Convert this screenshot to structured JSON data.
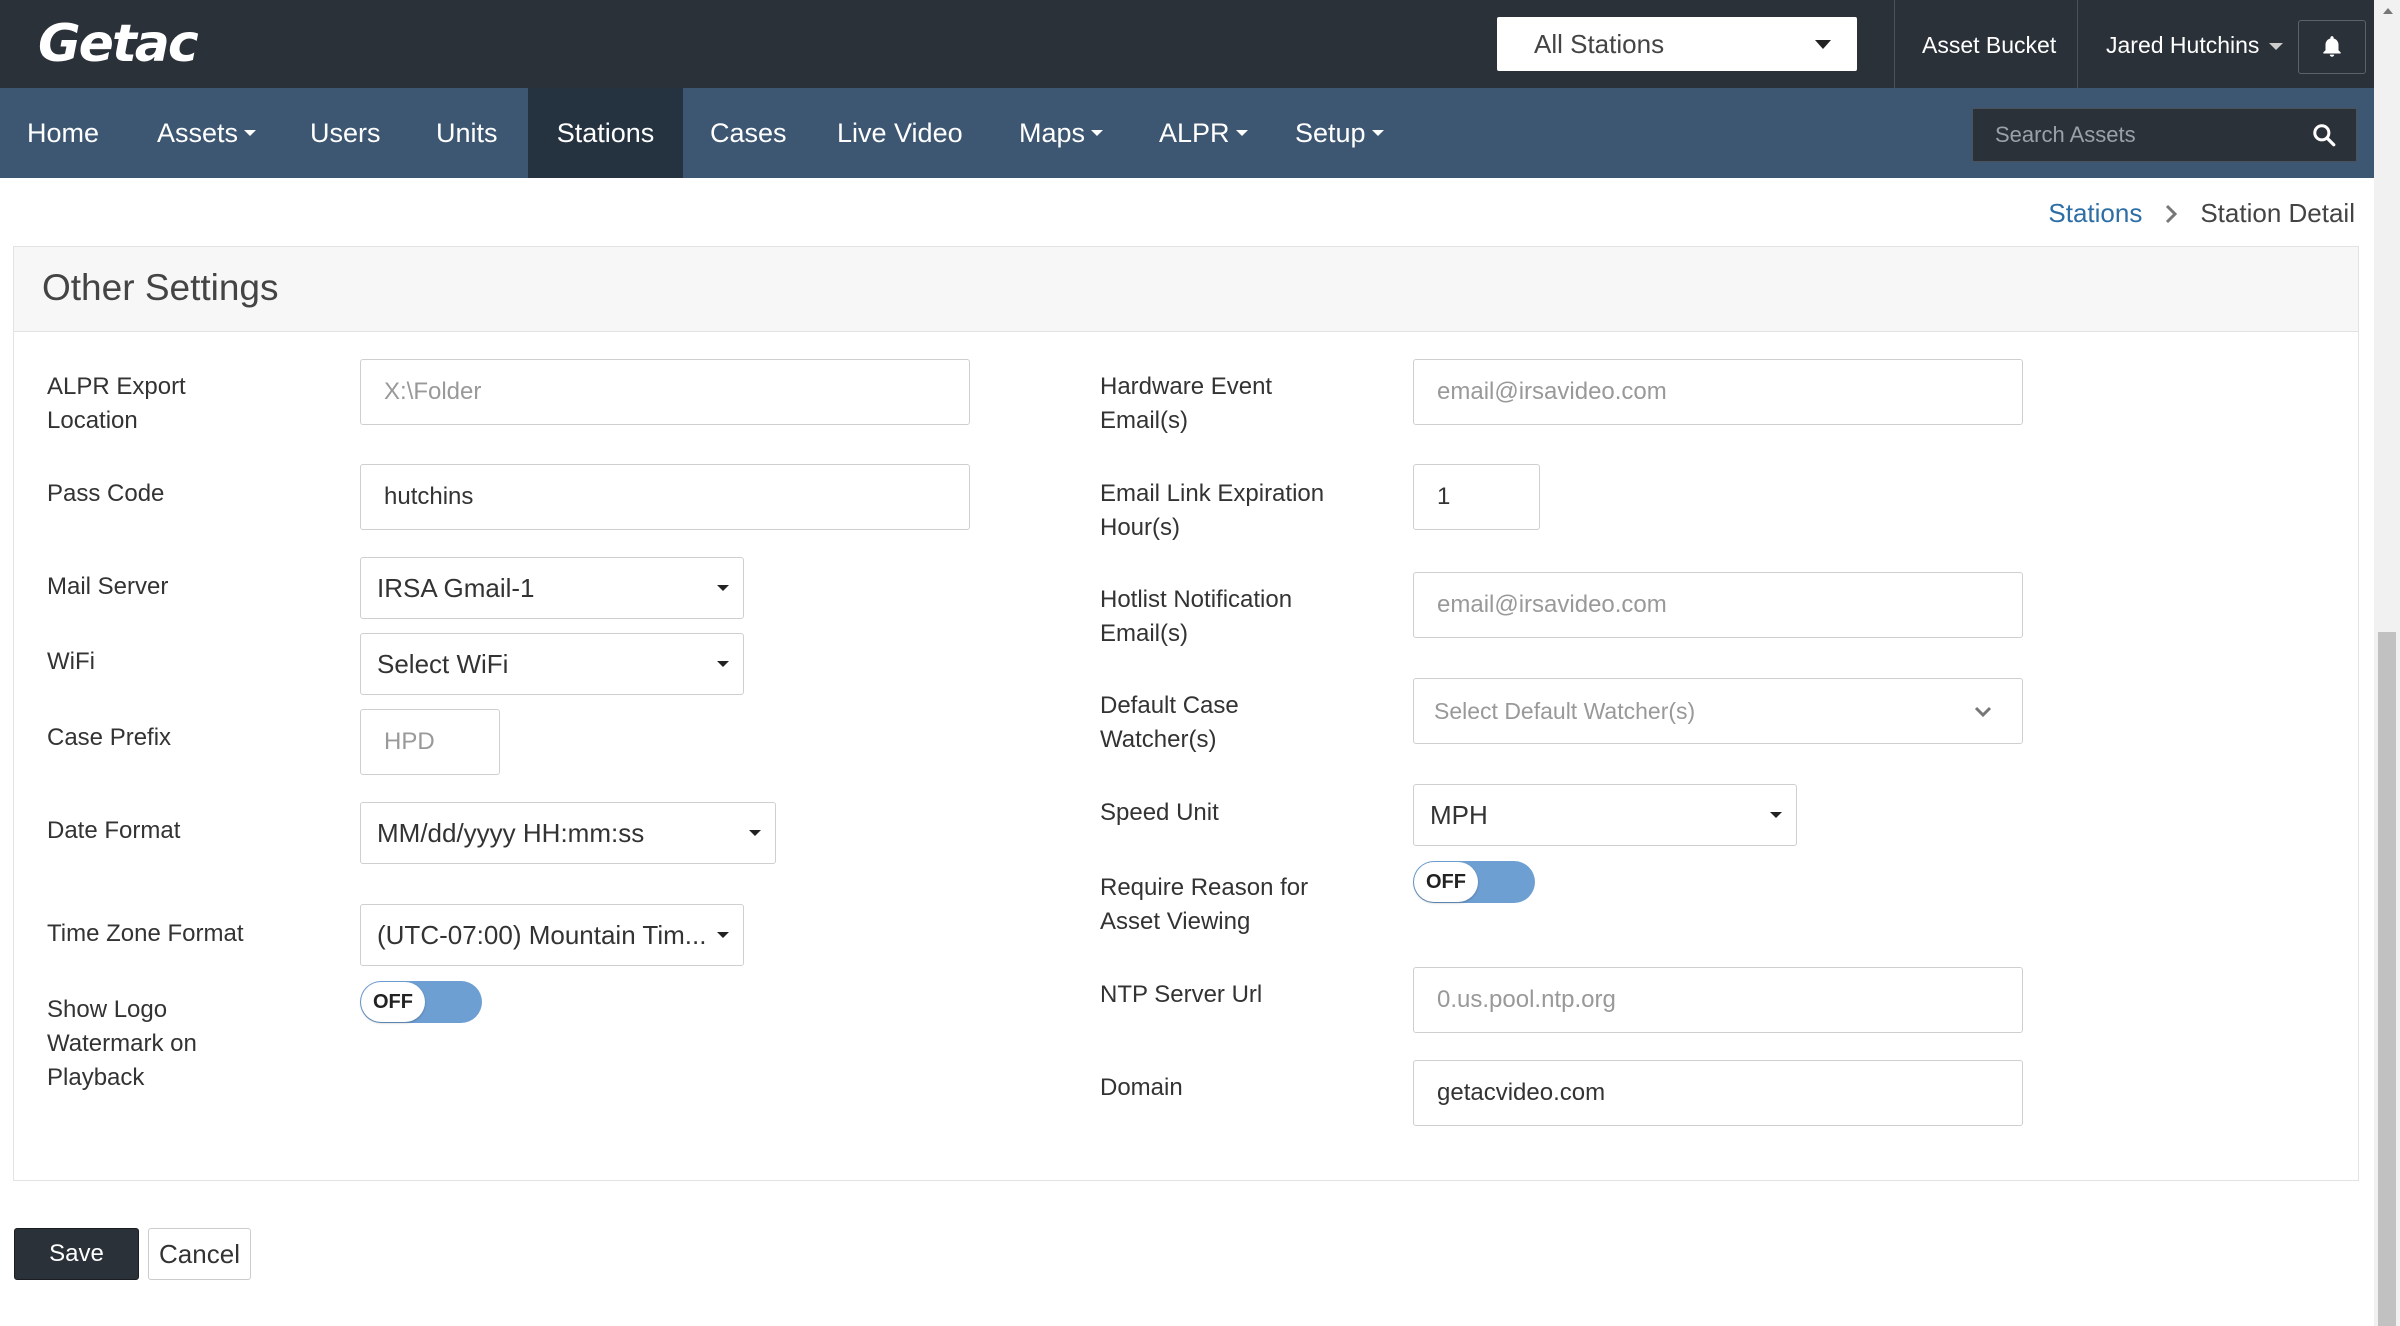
{
  "header": {
    "logo": "Getac",
    "station_select": "All Stations",
    "asset_bucket": "Asset Bucket",
    "user_name": "Jared Hutchins"
  },
  "nav": {
    "items": [
      {
        "label": "Home"
      },
      {
        "label": "Assets",
        "dropdown": true
      },
      {
        "label": "Users"
      },
      {
        "label": "Units"
      },
      {
        "label": "Stations",
        "active": true
      },
      {
        "label": "Cases"
      },
      {
        "label": "Live Video"
      },
      {
        "label": "Maps",
        "dropdown": true
      },
      {
        "label": "ALPR",
        "dropdown": true
      },
      {
        "label": "Setup",
        "dropdown": true
      }
    ],
    "search_placeholder": "Search Assets"
  },
  "breadcrumb": {
    "parent": "Stations",
    "current": "Station Detail"
  },
  "panel": {
    "title": "Other Settings"
  },
  "left": {
    "alpr_export_label": "ALPR Export Location",
    "alpr_export_placeholder": "X:\\Folder",
    "pass_code_label": "Pass Code",
    "pass_code_value": "hutchins",
    "mail_server_label": "Mail Server",
    "mail_server_value": "IRSA Gmail-1",
    "wifi_label": "WiFi",
    "wifi_value": "Select WiFi",
    "case_prefix_label": "Case Prefix",
    "case_prefix_placeholder": "HPD",
    "date_format_label": "Date Format",
    "date_format_value": "MM/dd/yyyy HH:mm:ss",
    "time_zone_label": "Time Zone Format",
    "time_zone_value": "(UTC-07:00) Mountain Tim...",
    "show_logo_label": "Show Logo Watermark on Playback",
    "show_logo_state": "OFF"
  },
  "right": {
    "hardware_event_label": "Hardware Event Email(s)",
    "hardware_event_placeholder": "email@irsavideo.com",
    "email_link_label": "Email Link Expiration Hour(s)",
    "email_link_value": "1",
    "hotlist_label": "Hotlist Notification Email(s)",
    "hotlist_placeholder": "email@irsavideo.com",
    "watcher_label": "Default Case Watcher(s)",
    "watcher_placeholder": "Select Default Watcher(s)",
    "speed_unit_label": "Speed Unit",
    "speed_unit_value": "MPH",
    "require_reason_label": "Require Reason for Asset Viewing",
    "require_reason_state": "OFF",
    "ntp_label": "NTP Server Url",
    "ntp_placeholder": "0.us.pool.ntp.org",
    "domain_label": "Domain",
    "domain_value": "getacvideo.com"
  },
  "actions": {
    "save": "Save",
    "cancel": "Cancel"
  },
  "colors": {
    "topbar": "#2b3138",
    "navbar": "#3d5671",
    "nav_active": "#253240",
    "link": "#2d6ea5",
    "toggle": "#6e9fd3"
  }
}
